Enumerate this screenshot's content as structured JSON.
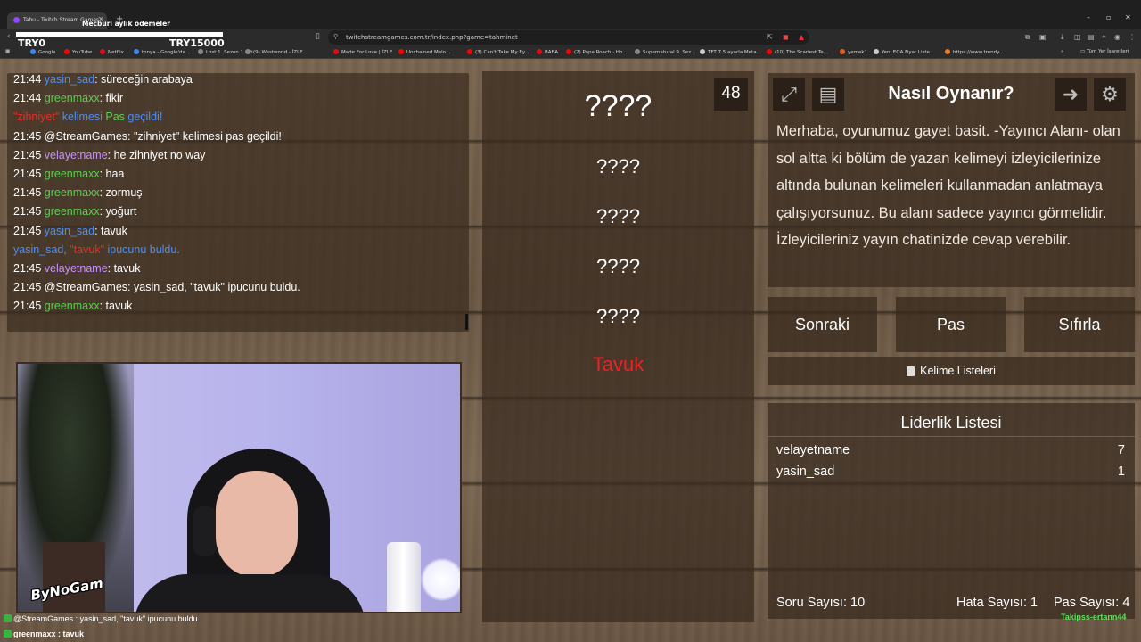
{
  "browser": {
    "tab_title": "Tabu - Twitch Stream Games",
    "url": "twitchstreamgames.com.tr/index.php?game=tahminet",
    "bookmarks": [
      {
        "label": "Google",
        "color": "#4285f4"
      },
      {
        "label": "YouTube",
        "color": "#ff0000"
      },
      {
        "label": "Netflix",
        "color": "#e50914"
      },
      {
        "label": "tonya - Google'da...",
        "color": "#4285f4"
      },
      {
        "label": "Lost 1. Sezon 1. Bö...",
        "color": "#888888"
      },
      {
        "label": "(9) Westworld - İZLE",
        "color": "#888888"
      },
      {
        "label": "Made For Love | İZLE",
        "color": "#e50914"
      },
      {
        "label": "Unchained Melo...",
        "color": "#ff0000"
      },
      {
        "label": "(3) Can't Take My Ey...",
        "color": "#ff0000"
      },
      {
        "label": "BABA",
        "color": "#e50914"
      },
      {
        "label": "(2) Papa Roach - Ho...",
        "color": "#ff0000"
      },
      {
        "label": "Supernatural 9. Sez...",
        "color": "#888888"
      },
      {
        "label": "TFT 7.5 ayarla Meta...",
        "color": "#cccccc"
      },
      {
        "label": "(10) The Scariest Te...",
        "color": "#ff0000"
      },
      {
        "label": "yemek1",
        "color": "#e06020"
      },
      {
        "label": "Yeni EQA Fiyat Liste...",
        "color": "#cccccc"
      },
      {
        "label": "https://www.trendy...",
        "color": "#f27a1a"
      }
    ],
    "all_bookmarks": "Tüm Yer İşaretleri"
  },
  "overlay": {
    "ad_text": "Mecburi aylık ödemeler",
    "left_amount": "TRY0",
    "right_amount": "TRY15000"
  },
  "chat": {
    "messages": [
      {
        "time": "21:44",
        "user": "yasin_sad",
        "user_color": "blue",
        "text": ": süreceğin arabaya"
      },
      {
        "time": "21:44",
        "user": "greenmaxx",
        "user_color": "green",
        "text": ": fikir"
      },
      {
        "system": true,
        "word": "\"zihniyet\"",
        "mid": " kelimesi ",
        "pas": "Pas",
        "end": " geçildi!"
      },
      {
        "time": "21:45",
        "user": "@StreamGames",
        "user_color": "white",
        "text": ": \"zihniyet\" kelimesi pas geçildi!"
      },
      {
        "time": "21:45",
        "user": "velayetname",
        "user_color": "purple",
        "text": ": he zihniyet no way"
      },
      {
        "time": "21:45",
        "user": "greenmaxx",
        "user_color": "green",
        "text": ": haa"
      },
      {
        "time": "21:45",
        "user": "greenmaxx",
        "user_color": "green",
        "text": ": zormuş"
      },
      {
        "time": "21:45",
        "user": "greenmaxx",
        "user_color": "green",
        "text": ": yoğurt"
      },
      {
        "time": "21:45",
        "user": "yasin_sad",
        "user_color": "blue",
        "text": ": tavuk"
      },
      {
        "system2": true,
        "user": "yasin_sad,",
        "word": "\"tavuk\"",
        "end": " ipucunu buldu."
      },
      {
        "time": "21:45",
        "user": "velayetname",
        "user_color": "purple",
        "text": ": tavuk"
      },
      {
        "time": "21:45",
        "user": "@StreamGames",
        "user_color": "white",
        "text": ": yasin_sad, \"tavuk\" ipucunu buldu."
      },
      {
        "time": "21:45",
        "user": "greenmaxx",
        "user_color": "green",
        "text": ": tavuk"
      }
    ]
  },
  "stream": {
    "logo": "ByNoGam",
    "ticker_line1": "@StreamGames : yasin_sad, \"tavuk\" ipucunu buldu.",
    "ticker_line2": "greenmaxx : tavuk",
    "follow_text": "Takipss-ertann44"
  },
  "game": {
    "timer": "48",
    "main_word": "????",
    "forbidden_words": [
      "????",
      "????",
      "????",
      "????"
    ],
    "answer_word": "Tavuk",
    "howto_title": "Nasıl Oynanır?",
    "howto_text": "Merhaba, oyunumuz gayet basit. -Yayıncı Alanı- olan sol altta ki bölüm de yazan kelimeyi izleyicilerinize altında bulunan kelimeleri kullanmadan anlatmaya çalışıyorsunuz. Bu alanı sadece yayıncı görmelidir. İzleyicileriniz yayın chatinizde cevap verebilir.",
    "buttons": {
      "next": "Sonraki",
      "pass": "Pas",
      "reset": "Sıfırla"
    },
    "word_lists": "Kelime Listeleri",
    "leaderboard_title": "Liderlik Listesi",
    "leaderboard": [
      {
        "name": "velayetname",
        "score": "7"
      },
      {
        "name": "yasin_sad",
        "score": "1"
      }
    ],
    "stats": {
      "questions": "Soru Sayısı: 10",
      "errors": "Hata Sayısı: 1",
      "passes": "Pas Sayısı: 4"
    }
  },
  "icons": [
    "fullscreen-icon",
    "notes-icon",
    "logout-icon",
    "settings-icon"
  ]
}
